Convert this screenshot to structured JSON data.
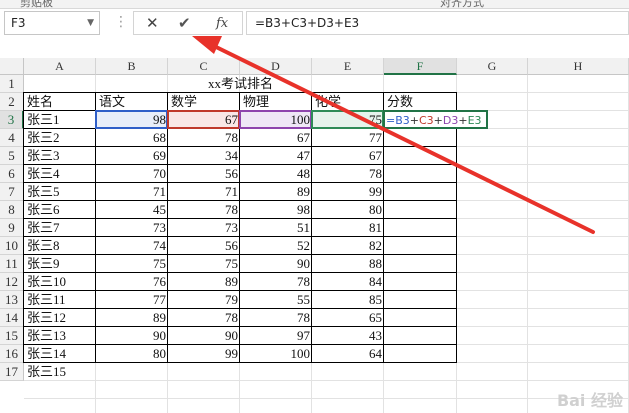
{
  "ribbon": {
    "left_text": "剪贴板",
    "mid_text": "对齐方式"
  },
  "formula_bar": {
    "name_box": "F3",
    "cancel_glyph": "✕",
    "enter_glyph": "✔",
    "fx_glyph": "fx",
    "formula": "=B3+C3+D3+E3"
  },
  "columns": [
    "A",
    "B",
    "C",
    "D",
    "E",
    "F",
    "G",
    "H"
  ],
  "rows": [
    "1",
    "2",
    "3",
    "4",
    "5",
    "6",
    "7",
    "8",
    "9",
    "10",
    "11",
    "12",
    "13",
    "14",
    "15",
    "16",
    "17"
  ],
  "sheet": {
    "title": "xx考试排名",
    "headers": [
      "姓名",
      "语文",
      "数学",
      "物理",
      "化学",
      "分数"
    ],
    "records": [
      {
        "name": "张三1",
        "yuwen": "98",
        "shuxue": "67",
        "wuli": "100",
        "huaxue": "75"
      },
      {
        "name": "张三2",
        "yuwen": "68",
        "shuxue": "78",
        "wuli": "67",
        "huaxue": "77"
      },
      {
        "name": "张三3",
        "yuwen": "69",
        "shuxue": "34",
        "wuli": "47",
        "huaxue": "67"
      },
      {
        "name": "张三4",
        "yuwen": "70",
        "shuxue": "56",
        "wuli": "48",
        "huaxue": "78"
      },
      {
        "name": "张三5",
        "yuwen": "71",
        "shuxue": "71",
        "wuli": "89",
        "huaxue": "99"
      },
      {
        "name": "张三6",
        "yuwen": "45",
        "shuxue": "78",
        "wuli": "98",
        "huaxue": "80"
      },
      {
        "name": "张三7",
        "yuwen": "73",
        "shuxue": "73",
        "wuli": "51",
        "huaxue": "81"
      },
      {
        "name": "张三8",
        "yuwen": "74",
        "shuxue": "56",
        "wuli": "52",
        "huaxue": "82"
      },
      {
        "name": "张三9",
        "yuwen": "75",
        "shuxue": "75",
        "wuli": "90",
        "huaxue": "88"
      },
      {
        "name": "张三10",
        "yuwen": "76",
        "shuxue": "89",
        "wuli": "78",
        "huaxue": "84"
      },
      {
        "name": "张三11",
        "yuwen": "77",
        "shuxue": "79",
        "wuli": "55",
        "huaxue": "85"
      },
      {
        "name": "张三12",
        "yuwen": "89",
        "shuxue": "78",
        "wuli": "78",
        "huaxue": "65"
      },
      {
        "name": "张三13",
        "yuwen": "90",
        "shuxue": "90",
        "wuli": "97",
        "huaxue": "43"
      },
      {
        "name": "张三14",
        "yuwen": "80",
        "shuxue": "99",
        "wuli": "100",
        "huaxue": "64"
      }
    ],
    "extra_row": "张三15",
    "active_cell_tokens": [
      {
        "text": "=B3",
        "color": "#2f5fc8"
      },
      {
        "text": "+",
        "color": "#333333"
      },
      {
        "text": "C3",
        "color": "#c0392b"
      },
      {
        "text": "+",
        "color": "#333333"
      },
      {
        "text": "D3",
        "color": "#8e44ad"
      },
      {
        "text": "+",
        "color": "#333333"
      },
      {
        "text": "E3",
        "color": "#2e8b57"
      }
    ]
  },
  "colors": {
    "ref_b": "#2f5fc8",
    "ref_c": "#c0392b",
    "ref_d": "#8e44ad",
    "ref_e": "#2e8b57",
    "arrow": "#e8322a",
    "selected": "#217346"
  },
  "watermark": "Bai 经验"
}
